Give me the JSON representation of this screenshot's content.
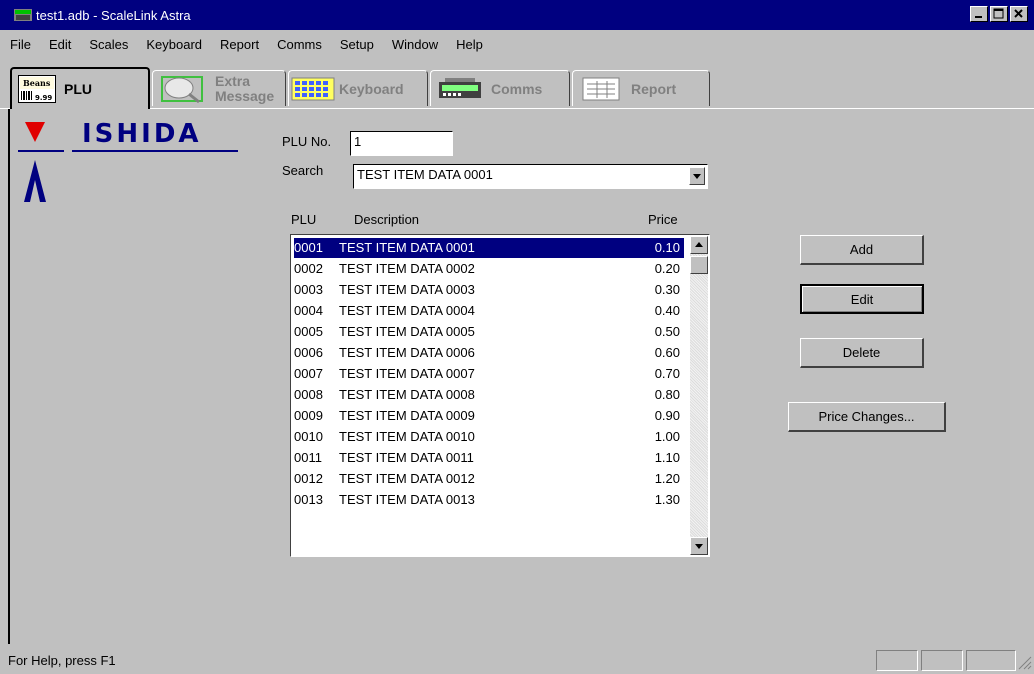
{
  "window": {
    "title": "test1.adb - ScaleLink Astra"
  },
  "menu": [
    "File",
    "Edit",
    "Scales",
    "Keyboard",
    "Report",
    "Comms",
    "Setup",
    "Window",
    "Help"
  ],
  "tabs": {
    "plu": {
      "label": "PLU",
      "icon_line1": "Beans",
      "icon_line2": "9.99"
    },
    "extra": {
      "line1": "Extra",
      "line2": "Message"
    },
    "keyboard": {
      "label": "Keyboard"
    },
    "comms": {
      "label": "Comms"
    },
    "report": {
      "label": "Report"
    }
  },
  "logo": {
    "brand": "ISHIDA",
    "colors": {
      "red": "#e00000",
      "navy": "#000080"
    }
  },
  "form": {
    "plu_no_label": "PLU No.",
    "plu_no_value": "1",
    "search_label": "Search",
    "search_value": "TEST ITEM DATA 0001"
  },
  "list": {
    "headers": {
      "plu": "PLU",
      "description": "Description",
      "price": "Price"
    },
    "rows": [
      {
        "plu": "0001",
        "description": "TEST ITEM DATA 0001",
        "price": "0.10",
        "selected": true
      },
      {
        "plu": "0002",
        "description": "TEST ITEM DATA 0002",
        "price": "0.20"
      },
      {
        "plu": "0003",
        "description": "TEST ITEM DATA 0003",
        "price": "0.30"
      },
      {
        "plu": "0004",
        "description": "TEST ITEM DATA 0004",
        "price": "0.40"
      },
      {
        "plu": "0005",
        "description": "TEST ITEM DATA 0005",
        "price": "0.50"
      },
      {
        "plu": "0006",
        "description": "TEST ITEM DATA 0006",
        "price": "0.60"
      },
      {
        "plu": "0007",
        "description": "TEST ITEM DATA 0007",
        "price": "0.70"
      },
      {
        "plu": "0008",
        "description": "TEST ITEM DATA 0008",
        "price": "0.80"
      },
      {
        "plu": "0009",
        "description": "TEST ITEM DATA 0009",
        "price": "0.90"
      },
      {
        "plu": "0010",
        "description": "TEST ITEM DATA 0010",
        "price": "1.00"
      },
      {
        "plu": "0011",
        "description": "TEST ITEM DATA 0011",
        "price": "1.10"
      },
      {
        "plu": "0012",
        "description": "TEST ITEM DATA 0012",
        "price": "1.20"
      },
      {
        "plu": "0013",
        "description": "TEST ITEM DATA 0013",
        "price": "1.30"
      }
    ]
  },
  "buttons": {
    "add": "Add",
    "edit": "Edit",
    "delete": "Delete",
    "price_changes": "Price Changes..."
  },
  "status": {
    "text": "For Help, press F1"
  },
  "colors": {
    "titlebar": "#000080",
    "selection": "#000080",
    "face": "#c0c0c0"
  }
}
